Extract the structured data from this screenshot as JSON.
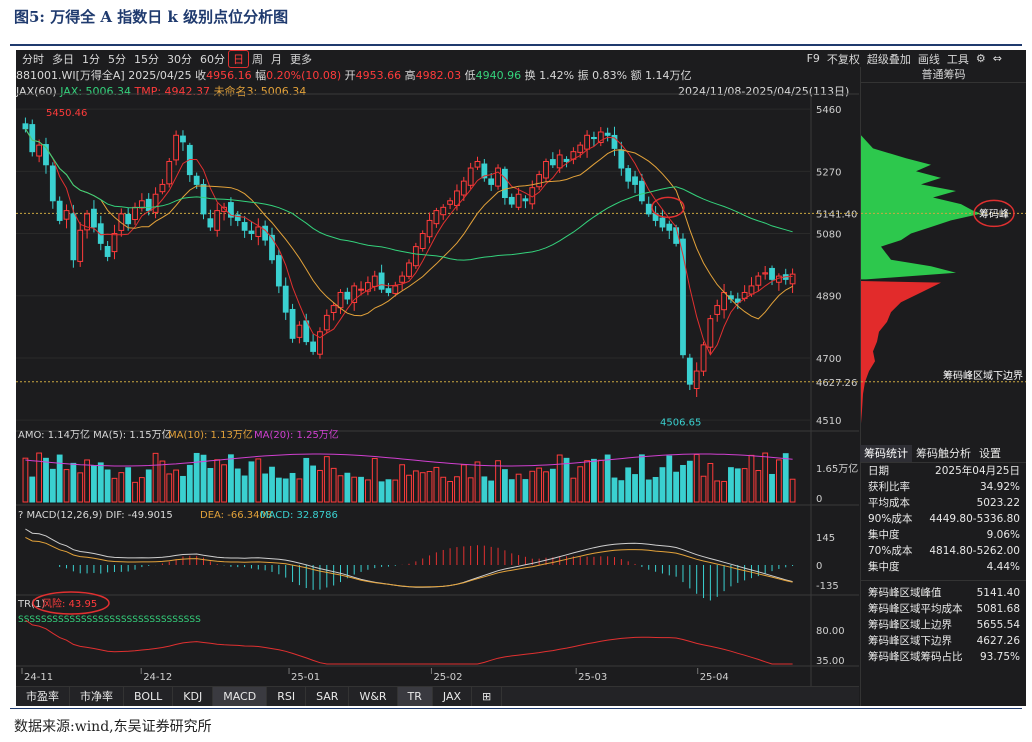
{
  "figure_title": "图5:  万得全 A 指数日 k 级别点位分析图",
  "source": "数据来源:wind,东吴证券研究所",
  "toolbar": {
    "periods": [
      "分时",
      "多日",
      "1分",
      "5分",
      "15分",
      "30分",
      "60分",
      "日",
      "周",
      "月",
      "更多"
    ],
    "active": "日"
  },
  "right_tools": [
    "F9",
    "不复权",
    "超级叠加",
    "画线",
    "工具",
    "⚙",
    "⇔"
  ],
  "info": {
    "code": "881001.WI[万得全A]",
    "date": "2025/04/25",
    "close_label": "收",
    "close": "4956.16",
    "chg_label": "幅",
    "chg": "0.20%(10.08)",
    "open_label": "开",
    "open": "4953.66",
    "high_label": "高",
    "high": "4982.03",
    "low_label": "低",
    "low": "4940.96",
    "turn": "换 1.42%",
    "amp": "振 0.83%",
    "amt": "额 1.14万亿"
  },
  "ma_labels": {
    "a": "JAX(60)",
    "b": "JAX: 5006.34",
    "c": "TMP: 4942.37",
    "d": "未命名3: 5006.34"
  },
  "range": "2024/11/08-2025/04/25(113日)",
  "right_panel": {
    "title": "普通筹码",
    "peak_label": "筹码峰",
    "lower_label": "筹码峰区域下边界"
  },
  "price_axis": [
    "5460",
    "5270",
    "5141.40",
    "5080",
    "4890",
    "4700",
    "4627.26",
    "4510"
  ],
  "annotations": {
    "high": "5450.46",
    "low": "4506.65"
  },
  "amo_label": "AMO: 1.14万亿 MA(5): 1.15万亿",
  "amo_ma10": "MA(10): 1.13万亿",
  "amo_ma20": "MA(20): 1.25万亿",
  "amo_axis": [
    "1.65万亿",
    "0"
  ],
  "macd_label": "MACD(12,26,9) DIF: -49.9015",
  "macd_dea": "DEA: -66.3408",
  "macd_val": "MACD: 32.8786",
  "macd_axis": [
    "145",
    "0",
    "-135"
  ],
  "tr_label": "TR(1)",
  "tr_risk": "风险: 43.95",
  "tr_axis": [
    "80.00",
    "35.00"
  ],
  "tr_signals": "SSSSSSSSSSSSSSSSSSSSSSSSSSSSSSSS",
  "date_axis": [
    "24-11",
    "24-12",
    "25-01",
    "25-02",
    "25-03",
    "25-04"
  ],
  "stats": {
    "tabs": [
      "筹码统计",
      "筹码触分析",
      "设置"
    ],
    "rows": [
      [
        "日期",
        "2025年04月25日"
      ],
      [
        "获利比率",
        "34.92%"
      ],
      [
        "平均成本",
        "5023.22"
      ],
      [
        "90%成本",
        "4449.80-5336.80"
      ],
      [
        "集中度",
        "9.06%"
      ],
      [
        "70%成本",
        "4814.80-5262.00"
      ],
      [
        "集中度",
        "4.44%"
      ]
    ],
    "rows2": [
      [
        "筹码峰区域峰值",
        "5141.40"
      ],
      [
        "筹码峰区域平均成本",
        "5081.68"
      ],
      [
        "筹码峰区域上边界",
        "5655.54"
      ],
      [
        "筹码峰区域下边界",
        "4627.26"
      ],
      [
        "筹码峰区域筹码占比",
        "93.75%"
      ]
    ]
  },
  "bottom_tabs": [
    "市盈率",
    "市净率",
    "BOLL",
    "KDJ",
    "MACD",
    "RSI",
    "SAR",
    "W&R",
    "TR",
    "JAX",
    "⊞"
  ],
  "bottom_active": [
    "MACD",
    "TR"
  ],
  "chart_data": {
    "type": "candlestick",
    "title": "万得全 A 指数日 k 级别点位分析图",
    "ylim": [
      4480,
      5500
    ],
    "closes": [
      5400,
      5330,
      5350,
      5290,
      5180,
      5120,
      5150,
      5000,
      5090,
      5140,
      5100,
      5050,
      5010,
      5080,
      5140,
      5110,
      5160,
      5180,
      5150,
      5200,
      5230,
      5300,
      5380,
      5360,
      5260,
      5230,
      5140,
      5100,
      5150,
      5160,
      5130,
      5120,
      5090,
      5080,
      5100,
      5060,
      5000,
      4920,
      4840,
      4760,
      4800,
      4750,
      4720,
      4780,
      4830,
      4860,
      4900,
      4880,
      4920,
      4910,
      4930,
      4950,
      4910,
      4900,
      4920,
      4950,
      4990,
      5040,
      5080,
      5120,
      5150,
      5160,
      5180,
      5210,
      5240,
      5280,
      5300,
      5250,
      5230,
      5280,
      5190,
      5170,
      5200,
      5180,
      5220,
      5260,
      5300,
      5290,
      5320,
      5300,
      5330,
      5350,
      5380,
      5370,
      5390,
      5380,
      5340,
      5280,
      5240,
      5230,
      5180,
      5140,
      5120,
      5100,
      5090,
      5050,
      4710,
      4620,
      4660,
      4740,
      4820,
      4860,
      4900,
      4880,
      4870,
      4900,
      4920,
      4950,
      4960,
      4940,
      4950,
      4940,
      4956
    ]
  }
}
